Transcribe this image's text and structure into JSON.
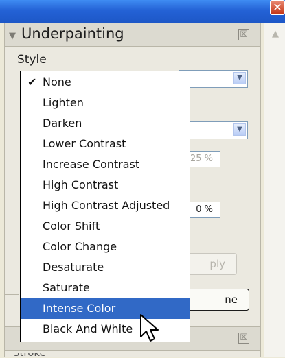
{
  "window": {
    "close_glyph": "✕"
  },
  "panel": {
    "title": "Underpainting",
    "close_glyph": "☒",
    "style_label": "Style",
    "field_percent_1": "25 %",
    "field_percent_2": "0 %",
    "apply_button_partial": "ply",
    "done_button_partial": "ne",
    "section2_close_glyph": "☒",
    "bottom_cut_text": "Stroke"
  },
  "dropdown": {
    "checkmark": "✔",
    "items": [
      {
        "label": "None",
        "checked": true,
        "selected": false
      },
      {
        "label": "Lighten",
        "checked": false,
        "selected": false
      },
      {
        "label": "Darken",
        "checked": false,
        "selected": false
      },
      {
        "label": "Lower Contrast",
        "checked": false,
        "selected": false
      },
      {
        "label": "Increase Contrast",
        "checked": false,
        "selected": false
      },
      {
        "label": "High Contrast",
        "checked": false,
        "selected": false
      },
      {
        "label": "High Contrast Adjusted",
        "checked": false,
        "selected": false
      },
      {
        "label": "Color Shift",
        "checked": false,
        "selected": false
      },
      {
        "label": "Color Change",
        "checked": false,
        "selected": false
      },
      {
        "label": "Desaturate",
        "checked": false,
        "selected": false
      },
      {
        "label": "Saturate",
        "checked": false,
        "selected": false
      },
      {
        "label": "Intense Color",
        "checked": false,
        "selected": true
      },
      {
        "label": "Black And White",
        "checked": false,
        "selected": false
      }
    ]
  },
  "colors": {
    "titlebar": "#2462d6",
    "panel_bg": "#ebe9e0",
    "selection": "#3169c6",
    "close_red": "#c33414"
  }
}
